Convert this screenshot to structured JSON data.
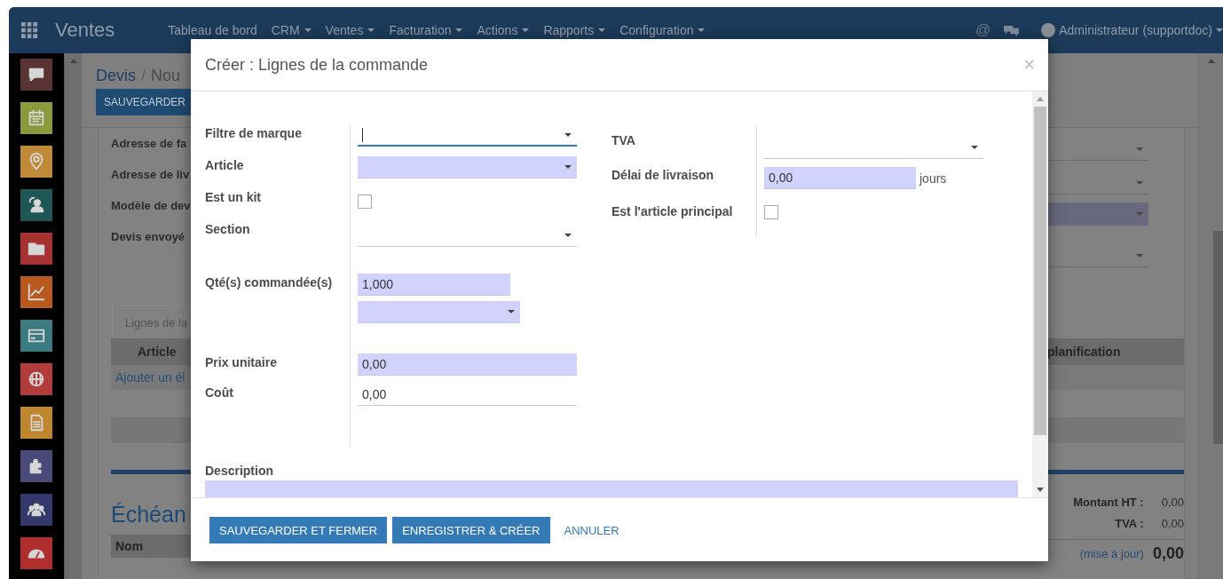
{
  "navbar": {
    "brand": "Ventes",
    "menus": [
      {
        "label": "Tableau de bord",
        "dropdown": false
      },
      {
        "label": "CRM",
        "dropdown": true
      },
      {
        "label": "Ventes",
        "dropdown": true
      },
      {
        "label": "Facturation",
        "dropdown": true
      },
      {
        "label": "Actions",
        "dropdown": true
      },
      {
        "label": "Rapports",
        "dropdown": true
      },
      {
        "label": "Configuration",
        "dropdown": true
      }
    ],
    "mention": "@",
    "user": "Administrateur (supportdoc)"
  },
  "sidebar": {
    "apps": [
      {
        "kind": "chat",
        "color": "#5a3434"
      },
      {
        "kind": "calendar",
        "color": "#8a9a3c"
      },
      {
        "kind": "pin",
        "color": "#c08a38"
      },
      {
        "kind": "contact",
        "color": "#1f5656"
      },
      {
        "kind": "folder",
        "color": "#a63232"
      },
      {
        "kind": "chart",
        "color": "#b85a20"
      },
      {
        "kind": "card",
        "color": "#3a7a80"
      },
      {
        "kind": "globe",
        "color": "#b23c3c"
      },
      {
        "kind": "document",
        "color": "#bf8630"
      },
      {
        "kind": "puzzle",
        "color": "#4a4a78"
      },
      {
        "kind": "people",
        "color": "#34386a"
      },
      {
        "kind": "gauge",
        "color": "#b02e2e"
      }
    ]
  },
  "breadcrumb": {
    "items": [
      "Devis",
      "Nou"
    ],
    "separator": "/"
  },
  "save_button": "SAUVEGARDER",
  "form": {
    "labels": [
      "Adresse de fa",
      "Adresse de liv",
      "Modèle de dev",
      "Devis envoyé"
    ],
    "fields": [
      {
        "required": false
      },
      {
        "required": false
      },
      {
        "required": true
      },
      {
        "required": false
      }
    ]
  },
  "notebook": {
    "tab": "Lignes de la",
    "columns": [
      "Article",
      "planification"
    ],
    "add_line": "Ajouter un él"
  },
  "schedule": {
    "title": "Échéan",
    "columns": [
      "Nom"
    ]
  },
  "totals": {
    "rows": [
      {
        "label": "Montant HT :",
        "value": "0,00"
      },
      {
        "label": "TVA :",
        "value": "0,00"
      }
    ],
    "update": "(mise à jour)",
    "total": "0,00"
  },
  "modal": {
    "title": "Créer : Lignes de la commande",
    "close": "×",
    "left_fields": [
      {
        "label": "Filtre de marque",
        "kind": "select",
        "required": false,
        "focused": true
      },
      {
        "label": "Article",
        "kind": "select",
        "required": true,
        "focused": false
      },
      {
        "label": "Est un kit",
        "kind": "checkbox",
        "checked": false
      },
      {
        "label": "Section",
        "kind": "select",
        "required": false,
        "focused": false
      },
      {
        "label": "Qté(s) commandée(s)",
        "kind": "quantity",
        "value": "1,000",
        "required": true,
        "unit_required": true,
        "focused": false
      },
      {
        "label": "Prix unitaire",
        "kind": "text",
        "value": "0,00",
        "required": true,
        "focused": false
      },
      {
        "label": "Coût",
        "kind": "text",
        "value": "0,00",
        "required": false,
        "focused": false
      }
    ],
    "right_fields": [
      {
        "label": "TVA",
        "kind": "select",
        "required": false,
        "focused": false
      },
      {
        "label": "Délai de livraison",
        "kind": "text",
        "value": "0,00",
        "suffix": "jours",
        "required": true,
        "focused": false
      },
      {
        "label": "Est l'article principal",
        "kind": "checkbox",
        "checked": false
      }
    ],
    "description": {
      "label": "Description",
      "required": true
    },
    "buttons": [
      {
        "label": "SAUVEGARDER ET FERMER",
        "kind": "primary"
      },
      {
        "label": "ENREGISTRER & CRÉER",
        "kind": "primary"
      },
      {
        "label": "ANNULER",
        "kind": "link"
      }
    ]
  }
}
